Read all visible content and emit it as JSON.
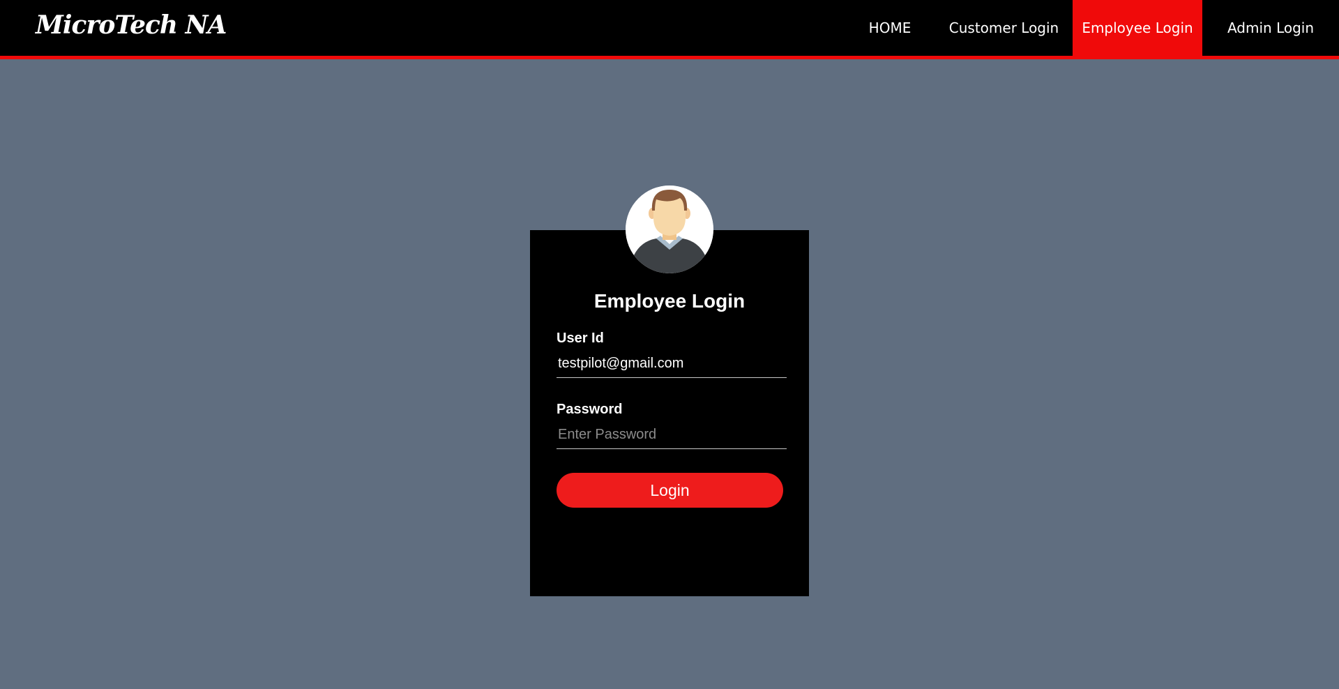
{
  "brand": {
    "name": "MicroTech NA"
  },
  "nav": {
    "items": [
      {
        "label": "HOME"
      },
      {
        "label": "Customer Login"
      },
      {
        "label": "Employee Login",
        "active": true
      },
      {
        "label": "Admin Login"
      }
    ]
  },
  "login": {
    "title": "Employee Login",
    "user_label": "User Id",
    "user_value": "testpilot@gmail.com",
    "password_label": "Password",
    "password_placeholder": "Enter Password",
    "button_label": "Login",
    "avatar_icon": "user-avatar-icon"
  },
  "colors": {
    "background": "#606e80",
    "navbar": "#000000",
    "accent": "#f00a0a",
    "button": "#ee1c1c",
    "card": "#000000"
  }
}
